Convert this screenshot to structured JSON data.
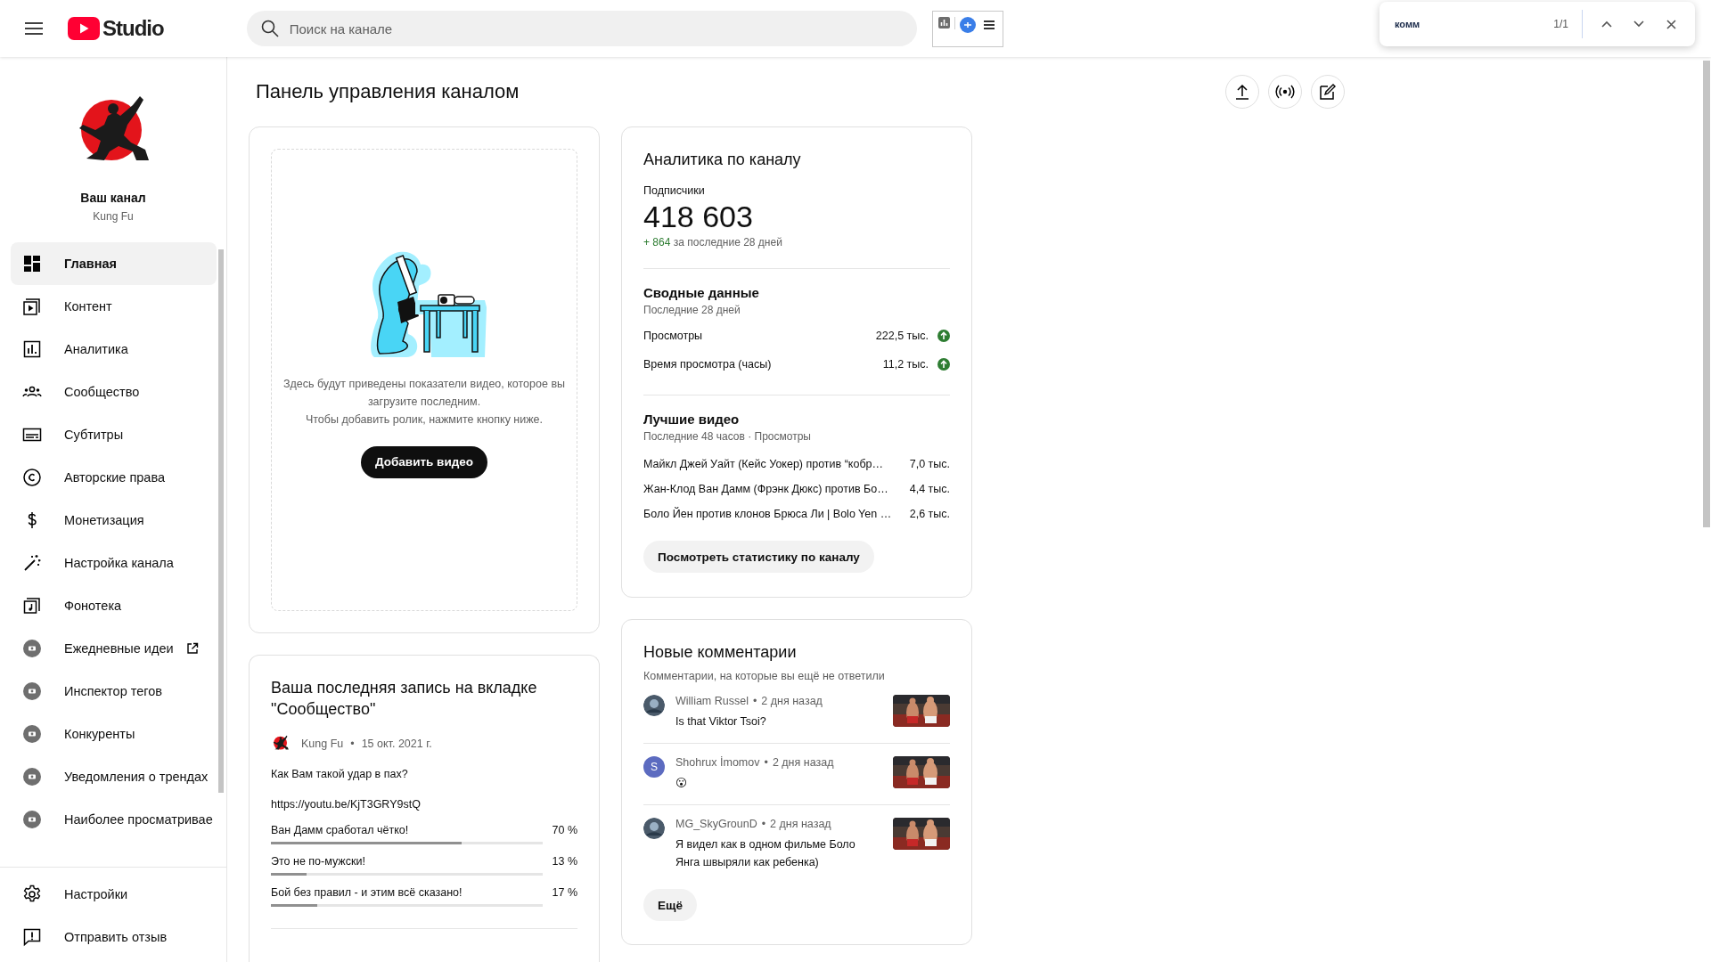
{
  "topbar": {
    "logo_text": "Studio",
    "search": {
      "placeholder": "Поиск на канале"
    }
  },
  "find_bar": {
    "query": "комм",
    "count": "1/1"
  },
  "sidebar": {
    "channel": {
      "title": "Ваш канал",
      "name": "Kung Fu"
    },
    "items": [
      {
        "label": "Главная",
        "kind": "page",
        "selected": true,
        "external": false
      },
      {
        "label": "Контент",
        "kind": "page",
        "selected": false,
        "external": false
      },
      {
        "label": "Аналитика",
        "kind": "page",
        "selected": false,
        "external": false
      },
      {
        "label": "Сообщество",
        "kind": "page",
        "selected": false,
        "external": false
      },
      {
        "label": "Субтитры",
        "kind": "page",
        "selected": false,
        "external": false
      },
      {
        "label": "Авторские права",
        "kind": "page",
        "selected": false,
        "external": false
      },
      {
        "label": "Монетизация",
        "kind": "page",
        "selected": false,
        "external": false
      },
      {
        "label": "Настройка канала",
        "kind": "page",
        "selected": false,
        "external": false
      },
      {
        "label": "Фонотека",
        "kind": "page",
        "selected": false,
        "external": false
      },
      {
        "label": "Ежедневные идеи",
        "kind": "extension",
        "selected": false,
        "external": true
      },
      {
        "label": "Инспектор тегов",
        "kind": "extension",
        "selected": false,
        "external": false
      },
      {
        "label": "Конкуренты",
        "kind": "extension",
        "selected": false,
        "external": false
      },
      {
        "label": "Уведомления о трендах",
        "kind": "extension",
        "selected": false,
        "external": false
      },
      {
        "label": "Наиболее просматривае",
        "kind": "extension",
        "selected": false,
        "external": false
      }
    ],
    "footer_items": [
      {
        "label": "Настройки"
      },
      {
        "label": "Отправить отзыв"
      }
    ]
  },
  "page": {
    "title": "Панель управления каналом"
  },
  "upload_card": {
    "message": [
      "Здесь будут приведены показатели видео, которое вы загрузите последним.",
      "Чтобы добавить ролик, нажмите кнопку ниже."
    ],
    "button": "Добавить видео"
  },
  "community": {
    "title": "Ваша последняя запись на вкладке \"Сообщество\"",
    "author": "Kung Fu",
    "separator": "•",
    "date": "15 окт. 2021 г.",
    "text": "Как Вам такой удар в пах?",
    "link": "https://youtu.be/KjT3GRY9stQ",
    "poll": [
      {
        "option": "Ван Дамм сработал чётко!",
        "percent": "70 %",
        "level": 0.7
      },
      {
        "option": "Это не по-мужски!",
        "percent": "13 %",
        "level": 0.13
      },
      {
        "option": "Бой без правил - и этим всё сказано!",
        "percent": "17 %",
        "level": 0.17
      }
    ]
  },
  "analytics": {
    "title": "Аналитика по каналу",
    "subscribers_label": "Подписчики",
    "subscribers": "418 603",
    "delta": "+ 864",
    "delta_text": "за последние 28 дней",
    "summary": {
      "title": "Сводные данные",
      "subtitle": "Последние 28 дней",
      "metrics": [
        {
          "label": "Просмотры",
          "value": "222,5 тыс.",
          "rising": true
        },
        {
          "label": "Время просмотра (часы)",
          "value": "11,2 тыс.",
          "rising": true
        }
      ]
    },
    "top_videos": {
      "title": "Лучшие видео",
      "subtitle": "Последние 48 часов · Просмотры",
      "videos": [
        {
          "title": "Майкл Джей Уайт (Кейс Уокер) против “кобр…",
          "views": "7,0 тыс."
        },
        {
          "title": "Жан-Клод Ван Дамм (Фрэнк Дюкс) против Бо…",
          "views": "4,4 тыс."
        },
        {
          "title": "Боло Йен против клонов Брюса Ли | Bolo Yen …",
          "views": "2,6 тыс."
        }
      ]
    },
    "button": "Посмотреть статистику по каналу"
  },
  "comments": {
    "title": "Новые комментарии",
    "subtitle": "Комментарии, на которые вы ещё не ответили",
    "separator": "•",
    "items": [
      {
        "author": "William Russel",
        "time": "2 дня назад",
        "text": "Is that Viktor Tsoi?"
      },
      {
        "author": "Shohrux İmomov",
        "time": "2 дня назад",
        "text": "😮",
        "avatar": {
          "kind": "letter",
          "letter": "S"
        }
      },
      {
        "author": "MG_SkyGrounD",
        "time": "2 дня назад",
        "text": "Я видел как в одном фильме Боло Янга швыряли как ребенка)"
      }
    ],
    "button": "Ещё"
  }
}
